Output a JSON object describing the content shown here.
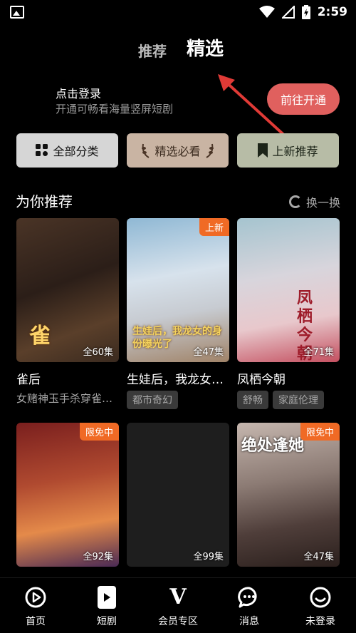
{
  "status_bar": {
    "time": "2:59"
  },
  "tabs": {
    "recommend": "推荐",
    "selected": "精选"
  },
  "login": {
    "title": "点击登录",
    "subtitle": "开通可畅看海量竖屏短剧",
    "button": "前往开通"
  },
  "categories": [
    {
      "label": "全部分类",
      "icon": "grid-icon"
    },
    {
      "label": "精选必看",
      "icon": "laurel-icon"
    },
    {
      "label": "上新推荐",
      "icon": "bookmark-icon"
    }
  ],
  "section": {
    "title": "为你推荐",
    "refresh": "换一换"
  },
  "cards": [
    {
      "title": "雀后",
      "episodes": "全60集",
      "desc": "女赌神玉手杀穿雀…",
      "badge": "",
      "poster_text": "雀"
    },
    {
      "title": "生娃后，我龙女…",
      "episodes": "全47集",
      "badge": "上新",
      "tags": [
        "都市奇幻"
      ],
      "poster_text": "生娃后，我龙女的身份曝光了"
    },
    {
      "title": "凤栖今朝",
      "episodes": "全71集",
      "badge": "",
      "tags": [
        "舒畅",
        "家庭伦理"
      ],
      "poster_text": "凤栖今朝"
    },
    {
      "title": "",
      "episodes": "全92集",
      "badge": "限免中",
      "poster_text": ""
    },
    {
      "title": "",
      "episodes": "全99集",
      "badge": "",
      "poster_text": ""
    },
    {
      "title": "",
      "episodes": "全47集",
      "badge": "限免中",
      "poster_text": "绝处逢她"
    }
  ],
  "bottom_nav": [
    {
      "label": "首页",
      "icon": "play-circle-icon"
    },
    {
      "label": "短剧",
      "icon": "short-drama-icon"
    },
    {
      "label": "会员专区",
      "icon": "vip-v-icon"
    },
    {
      "label": "消息",
      "icon": "message-icon"
    },
    {
      "label": "未登录",
      "icon": "smile-icon"
    }
  ],
  "colors": {
    "accent": "#e0605e",
    "badge": "#f06a25"
  }
}
